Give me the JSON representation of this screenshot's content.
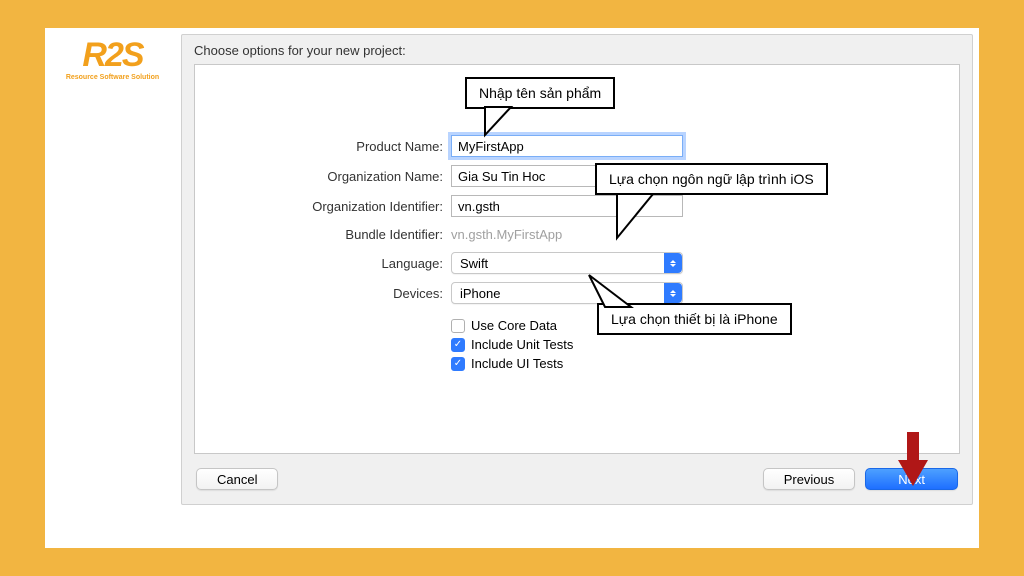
{
  "logo": {
    "mark": "R2S",
    "sub": "Resource Software Solution"
  },
  "dialog": {
    "title": "Choose options for your new project:",
    "fields": {
      "product_name": {
        "label": "Product Name:",
        "value": "MyFirstApp"
      },
      "org_name": {
        "label": "Organization Name:",
        "value": "Gia Su Tin Hoc"
      },
      "org_id": {
        "label": "Organization Identifier:",
        "value": "vn.gsth"
      },
      "bundle_id": {
        "label": "Bundle Identifier:",
        "value": "vn.gsth.MyFirstApp"
      },
      "language": {
        "label": "Language:",
        "value": "Swift"
      },
      "devices": {
        "label": "Devices:",
        "value": "iPhone"
      }
    },
    "checks": {
      "core_data": {
        "label": "Use Core Data",
        "checked": false
      },
      "unit_tests": {
        "label": "Include Unit Tests",
        "checked": true
      },
      "ui_tests": {
        "label": "Include UI Tests",
        "checked": true
      }
    },
    "buttons": {
      "cancel": "Cancel",
      "previous": "Previous",
      "next": "Next"
    }
  },
  "callouts": {
    "c1": "Nhập tên sản phẩm",
    "c2": "Lựa chọn ngôn ngữ lập trình iOS",
    "c3": "Lựa chọn thiết bị là iPhone"
  }
}
